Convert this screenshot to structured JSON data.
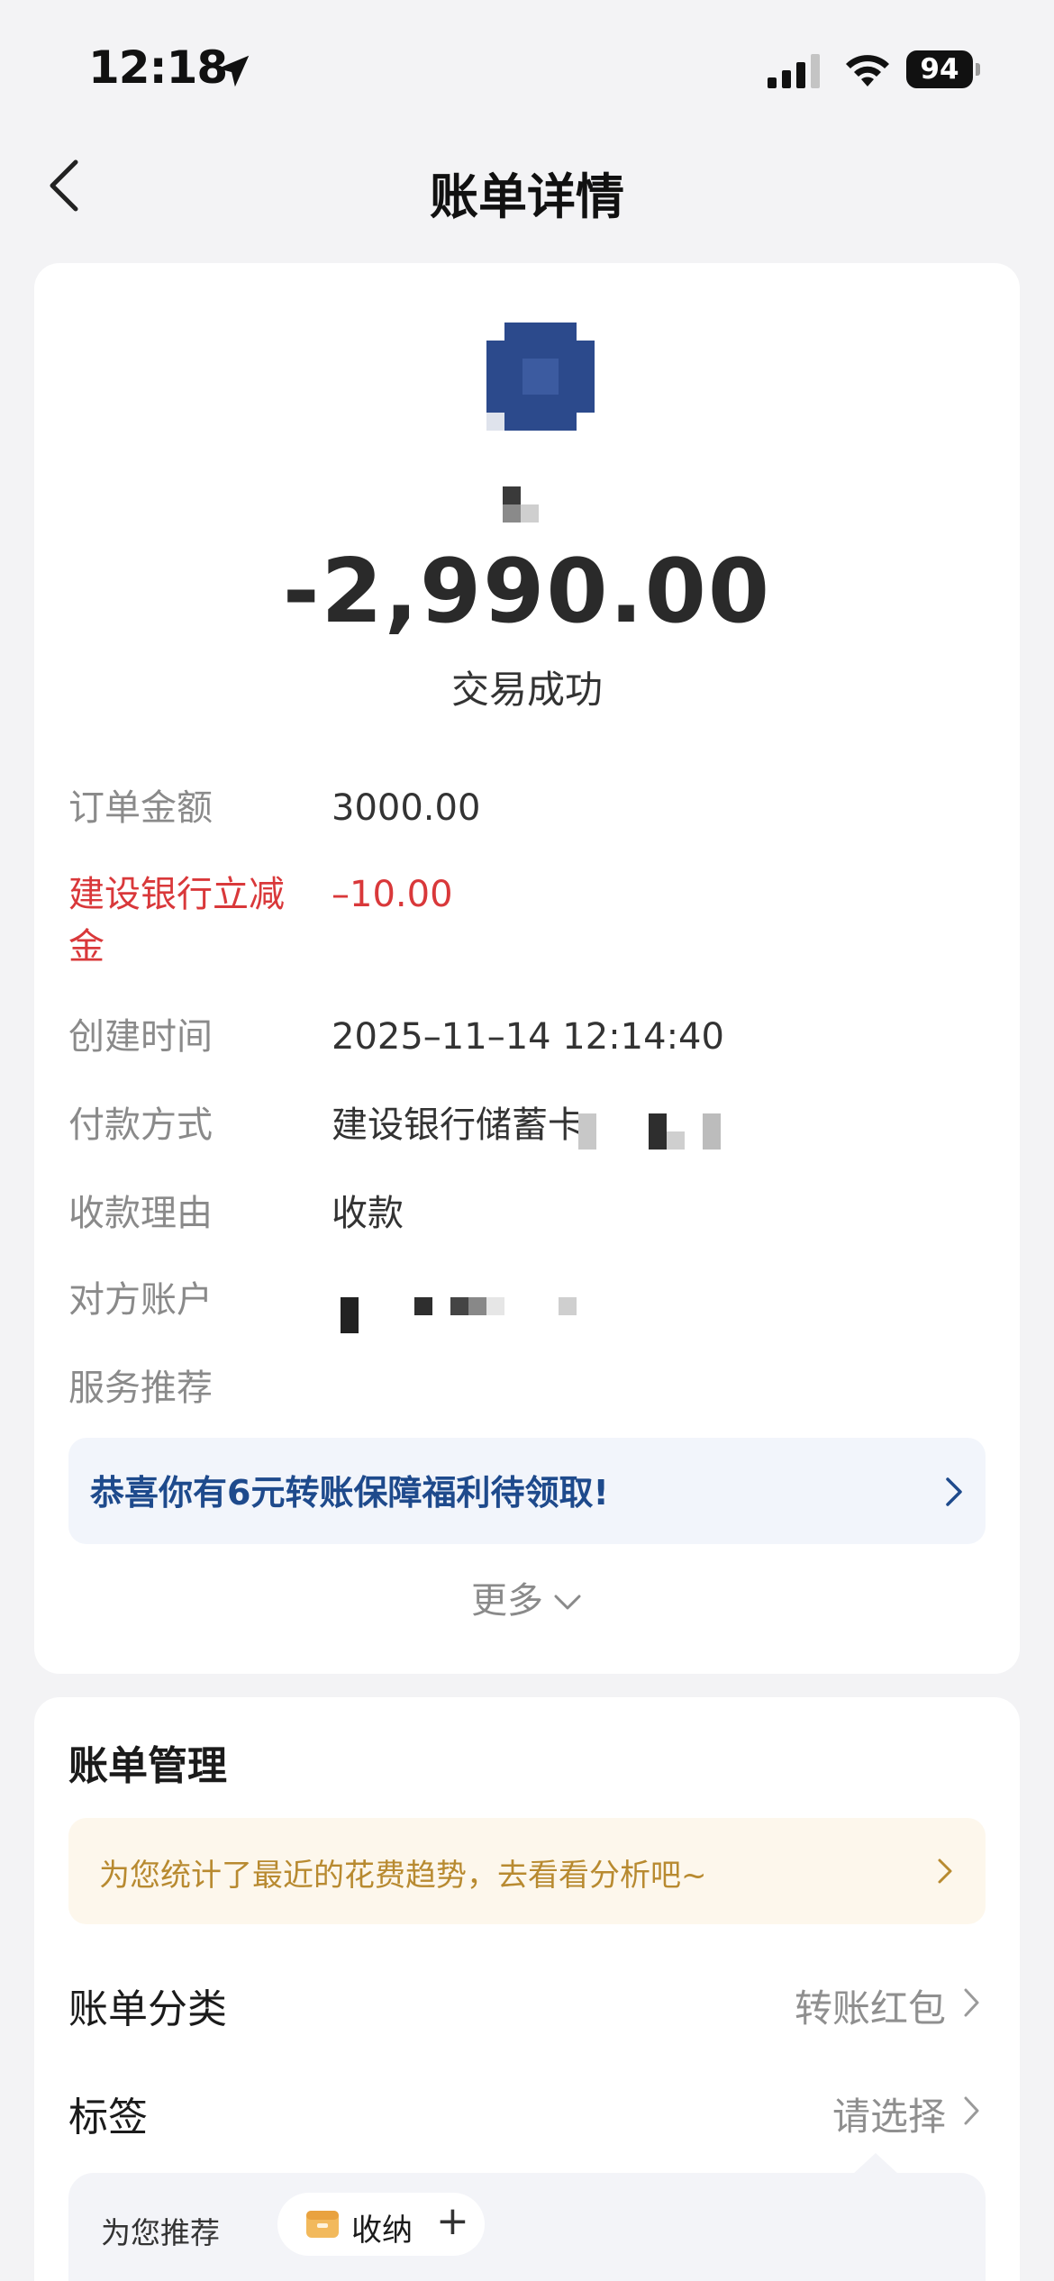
{
  "status_bar": {
    "time": "12:18",
    "battery": "94"
  },
  "nav": {
    "title": "账单详情"
  },
  "transaction": {
    "amount": "-2,990.00",
    "status": "交易成功"
  },
  "details": {
    "order_amount": {
      "label": "订单金额",
      "value": "3000.00"
    },
    "discount": {
      "label": "建设银行立减金",
      "value": "–10.00"
    },
    "created_time": {
      "label": "创建时间",
      "value": "2025–11–14 12:14:40"
    },
    "payment_method": {
      "label": "付款方式",
      "value": "建设银行储蓄卡"
    },
    "reason": {
      "label": "收款理由",
      "value": "收款"
    },
    "counterparty": {
      "label": "对方账户"
    },
    "service": {
      "label": "服务推荐"
    }
  },
  "promo": {
    "text": "恭喜你有6元转账保障福利待领取!"
  },
  "more": {
    "label": "更多"
  },
  "management": {
    "title": "账单管理",
    "analysis_text": "为您统计了最近的花费趋势，去看看分析吧~",
    "category": {
      "label": "账单分类",
      "value": "转账红包"
    },
    "tags": {
      "label": "标签",
      "value": "请选择"
    },
    "recommend": {
      "label": "为您推荐",
      "tag": "收纳"
    }
  },
  "colors": {
    "accent_red": "#d9383a",
    "promo_blue": "#1e4a8c",
    "analysis_gold": "#b88a30"
  }
}
